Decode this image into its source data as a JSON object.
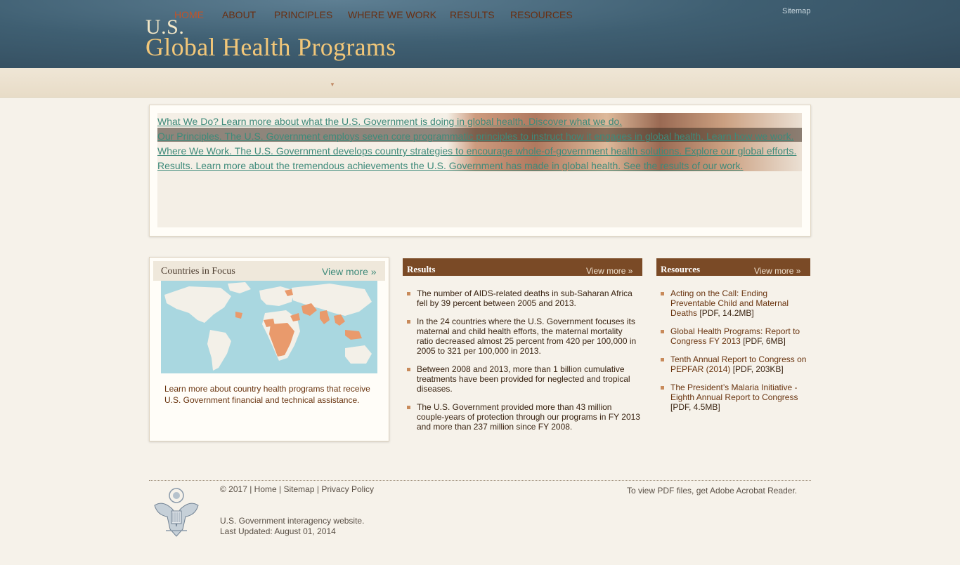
{
  "header": {
    "logo_line1": "U.S.",
    "logo_line2": "Global Health Programs",
    "sitemap": "Sitemap"
  },
  "nav": {
    "items": [
      {
        "label": "HOME",
        "active": true
      },
      {
        "label": "ABOUT"
      },
      {
        "label": "PRINCIPLES",
        "has_dropdown": true
      },
      {
        "label": "WHERE WE WORK"
      },
      {
        "label": "RESULTS"
      },
      {
        "label": "RESOURCES"
      }
    ],
    "dropdown_icon": "triangle-down-icon"
  },
  "slider": {
    "lines": [
      "What We Do? Learn more about what the U.S. Government is doing in global health. Discover what we do.",
      "Our Principles. The U.S. Government employs seven core programmatic principles to instruct how it engages in global health. Learn how we work.",
      "Where We Work. The U.S. Government develops country strategies to encourage whole-of-government health solutions. Explore our global efforts.",
      "Results. Learn more about the tremendous achievements the U.S. Government has made in global health. See the results of our work."
    ]
  },
  "countries": {
    "title": "Countries in Focus",
    "view_more": "View more »",
    "description": "Learn more about country health programs that receive U.S. Government financial and technical assistance."
  },
  "results": {
    "title": "Results",
    "view_more": "View more »",
    "items": [
      "The number of AIDS-related deaths in sub-Saharan Africa fell by 39 percent between 2005 and 2013.",
      "In the 24 countries where the U.S. Government focuses its maternal and child health efforts, the maternal mortality ratio decreased almost 25 percent from 420 per 100,000 in 2005 to 321 per 100,000 in 2013.",
      "Between 2008 and 2013, more than 1 billion cumulative treatments have been provided for neglected and tropical diseases.",
      "The U.S. Government provided more than 43 million couple-years of protection through our programs in FY 2013 and more than 237 million since FY 2008."
    ]
  },
  "resources": {
    "title": "Resources",
    "view_more": "View more »",
    "items": [
      {
        "label": "Acting on the Call: Ending Preventable Child and Maternal Deaths",
        "meta": "[PDF, 14.2MB]"
      },
      {
        "label": "Global Health Programs: Report to Congress FY 2013",
        "meta": "[PDF, 6MB]"
      },
      {
        "label": "Tenth Annual Report to Congress on PEPFAR (2014)",
        "meta": "[PDF, 203KB]"
      },
      {
        "label": "The President’s Malaria Initiative - Eighth Annual Report to Congress",
        "meta": "[PDF, 4.5MB]"
      }
    ]
  },
  "footer": {
    "copyright": "© 2017",
    "links": [
      "Home",
      "Sitemap",
      "Privacy Policy"
    ],
    "pdf_prefix": "To view PDF files, get ",
    "pdf_link": "Adobe Acrobat Reader.",
    "note_line1": "U.S. Government interagency website.",
    "note_line2": "Last Updated: August 01, 2014",
    "seal_icon": "us-seal-icon"
  },
  "colors": {
    "header_bg": "#3f5f72",
    "logo_gold": "#f2c779",
    "nav_text": "#6a2e10",
    "nav_active": "#c0532a",
    "accent_teal": "#3e8a7a",
    "column_head": "#7a4a26",
    "page_bg": "#f6f2ea"
  }
}
